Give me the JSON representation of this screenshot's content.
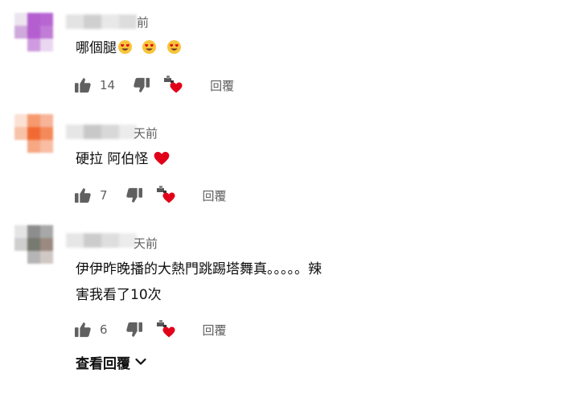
{
  "comments": [
    {
      "time_label": "前",
      "text": "哪個腿",
      "emojis": [
        "heart-eyes-emoji",
        "heart-eyes-emoji",
        "heart-eyes-emoji"
      ],
      "like_count": "14",
      "reply_label": "回覆"
    },
    {
      "time_label": "天前",
      "text": "硬拉 阿伯怪",
      "emojis": [
        "red-heart-emoji"
      ],
      "like_count": "7",
      "reply_label": "回覆"
    },
    {
      "time_label": "天前",
      "text_line1": "伊伊昨晚播的大熱門跳踢塔舞真。。。。。辣",
      "text_line2": "害我看了10次",
      "like_count": "6",
      "reply_label": "回覆"
    }
  ],
  "view_replies_label": "查看回覆",
  "colors": {
    "secondary_text": "#606060",
    "primary_text": "#0f0f0f",
    "heart": "#e0001a"
  }
}
